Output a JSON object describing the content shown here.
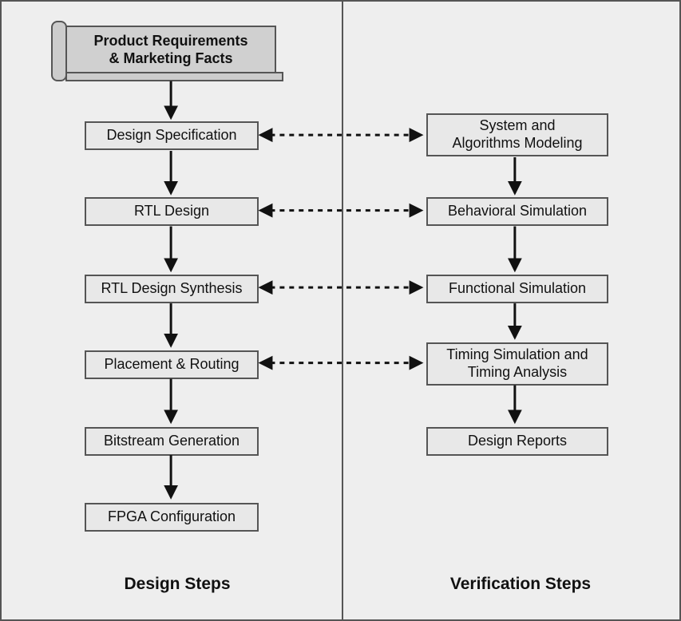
{
  "left_label": "Design Steps",
  "right_label": "Verification Steps",
  "scroll_box": "Product Requirements\n& Marketing Facts",
  "left": {
    "b1": "Design Specification",
    "b2": "RTL Design",
    "b3": "RTL Design Synthesis",
    "b4": "Placement & Routing",
    "b5": "Bitstream Generation",
    "b6": "FPGA Configuration"
  },
  "right": {
    "r1": "System and\nAlgorithms Modeling",
    "r2": "Behavioral Simulation",
    "r3": "Functional Simulation",
    "r4": "Timing Simulation and\nTiming Analysis",
    "r5": "Design Reports"
  }
}
